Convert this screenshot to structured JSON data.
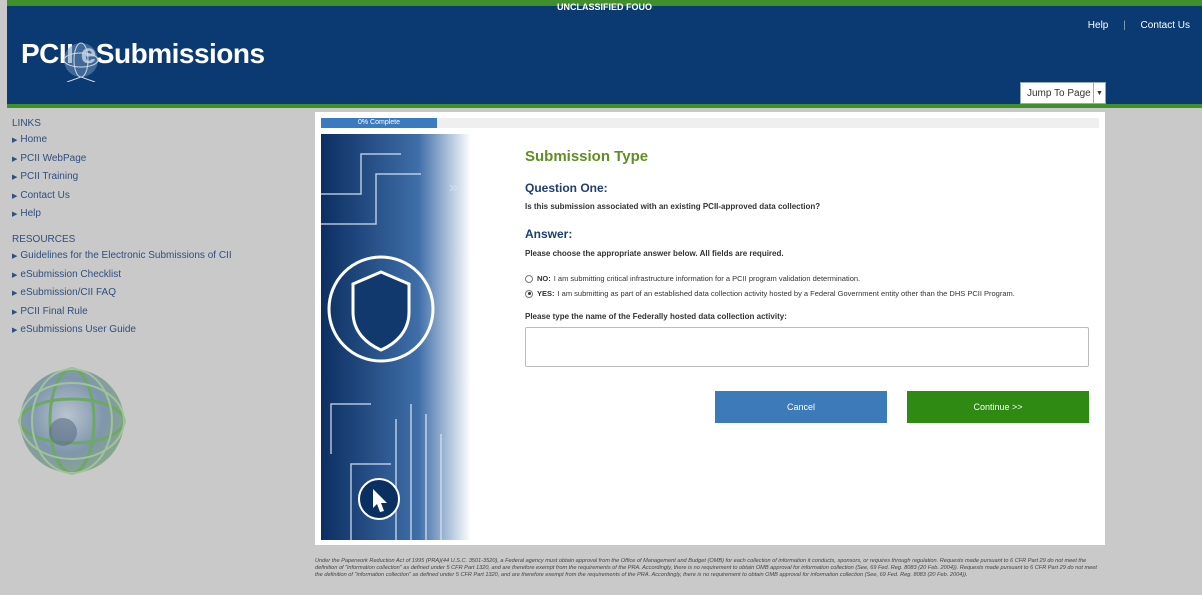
{
  "header": {
    "banner": "UNCLASSIFIED FOUO",
    "logo_text": "PCII eSubmissions",
    "links": {
      "help": "Help",
      "separator": "|",
      "contact": "Contact Us"
    },
    "jump_to_page": "Jump To Page"
  },
  "sidebar": {
    "links_heading": "LINKS",
    "links": [
      {
        "label": "Home"
      },
      {
        "label": "PCII WebPage"
      },
      {
        "label": "PCII Training"
      },
      {
        "label": "Contact Us"
      },
      {
        "label": "Help"
      }
    ],
    "resources_heading": "RESOURCES",
    "resources": [
      {
        "label": "Guidelines for the Electronic Submissions of CII"
      },
      {
        "label": "eSubmission Checklist"
      },
      {
        "label": "eSubmission/CII FAQ"
      },
      {
        "label": "PCII Final Rule"
      },
      {
        "label": "eSubmissions User Guide"
      }
    ]
  },
  "progress": {
    "label": "0% Complete",
    "percent": 0
  },
  "form": {
    "section_title": "Submission Type",
    "question_title": "Question One:",
    "question_text": "Is this submission associated with an existing PCII-approved data collection?",
    "answer_title": "Answer:",
    "answer_instructions": "Please choose the appropriate answer below. All fields are required.",
    "option_no": {
      "label": "NO:",
      "text": "I am submitting critical infrastructure information for a PCII program validation determination.",
      "selected": false
    },
    "option_yes": {
      "label": "YES:",
      "text": "I am submitting as part of an established data collection activity hosted by a Federal Government entity other than the DHS PCII Program.",
      "selected": true
    },
    "field_label": "Please type the name of the Federally hosted data collection activity:",
    "field_value": "",
    "cancel": "Cancel",
    "continue": "Continue >>"
  },
  "footer": "Under the Paperwork Reduction Act of 1995 (PRA)(44 U.S.C. 3501-3520), a Federal agency must obtain approval from the Office of Management and Budget (OMB) for each collection of information it conducts, sponsors, or requires through regulation. Requests made pursuant to 6 CFR Part 29 do not meet the definition of \"information collection\" as defined under 5 CFR Part 1320, and are therefore exempt from the requirements of the PRA. Accordingly, there is no requirement to obtain OMB approval for information collection (See, 69 Fed. Reg. 8083 (20 Feb. 2004)). Requests made pursuant to 6 CFR Part 29 do not meet the definition of \"information collection\" as defined under 5 CFR Part 1320, and are therefore exempt from the requirements of the PRA. Accordingly, there is no requirement to obtain OMB approval for information collection (See, 69 Fed. Reg. 8083 (20 Feb. 2004)).",
  "colors": {
    "header_blue": "#0b3a72",
    "accent_green": "#3f8f2a",
    "cancel_blue": "#3c7ab9",
    "continue_green": "#2e8a12"
  }
}
